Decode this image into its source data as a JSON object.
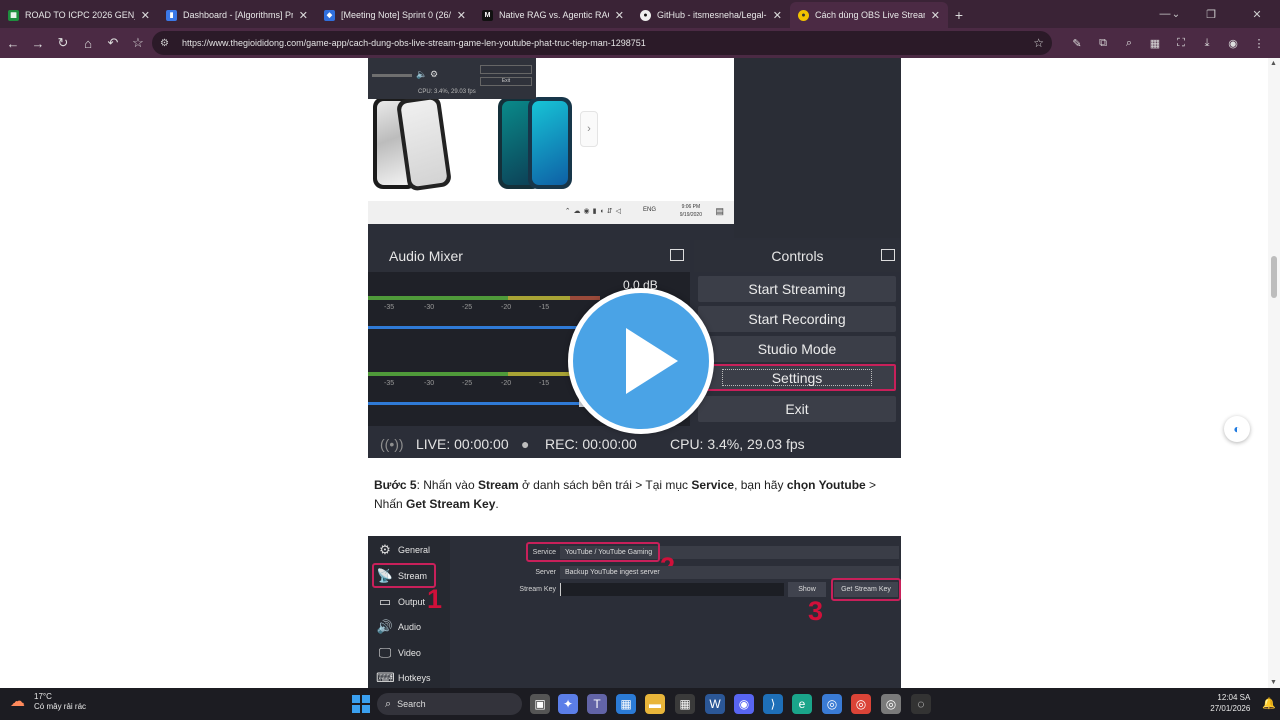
{
  "browser": {
    "tabs": [
      {
        "title": "ROAD TO ICPC 2026 GEN_TEST",
        "favicon": "sheets-icon",
        "color": "#1e8e3e",
        "active": false
      },
      {
        "title": "Dashboard - [Algorithms] Prefix",
        "favicon": "chart-icon",
        "color": "#3b78e7",
        "active": false
      },
      {
        "title": "[Meeting Note] Sprint 0 (26/01)",
        "favicon": "jira-icon",
        "color": "#2f6fde",
        "active": false
      },
      {
        "title": "Native RAG vs. Agentic RAG: W",
        "favicon": "medium-icon",
        "color": "#111111",
        "active": false
      },
      {
        "title": "GitHub - itsmesneha/Legal-Ch",
        "favicon": "github-icon",
        "color": "#eeeeee",
        "active": false
      },
      {
        "title": "Cách dùng OBS Live Stream ga",
        "favicon": "tgdd-icon",
        "color": "#f2c200",
        "active": true
      }
    ],
    "url": "https://www.thegioididong.com/game-app/cach-dung-obs-live-stream-game-len-youtube-phat-truc-tiep-man-1298751"
  },
  "screenshot1": {
    "mini_obs_stat": "CPU: 3.4%, 29.03 fps",
    "mini_obs_button": "Exit",
    "tray_time": "9:06 PM",
    "tray_date": "9/19/2020",
    "tray_lang": "ENG",
    "audio_mixer_title": "Audio Mixer",
    "controls_title": "Controls",
    "db_value": "0.0 dB",
    "scale_ticks": [
      "-35",
      "-30",
      "-25",
      "-20",
      "-15",
      "-10"
    ],
    "buttons": [
      "Start Streaming",
      "Start Recording",
      "Studio Mode",
      "Settings",
      "Exit"
    ],
    "highlighted_button": "Settings",
    "live": "LIVE: 00:00:00",
    "rec": "REC: 00:00:00",
    "cpu": "CPU: 3.4%, 29.03 fps"
  },
  "article": {
    "step_label": "Bước 5",
    "p1": ": Nhấn vào ",
    "b1": "Stream",
    "p2": " ở danh sách bên trái > Tại mục ",
    "b2": "Service",
    "p3": ", bạn hãy ",
    "b3": "chọn Youtube",
    "p4": " > Nhấn ",
    "b4": "Get Stream Key",
    "p5": "."
  },
  "screenshot2": {
    "sidebar": [
      {
        "label": "General",
        "icon": "gear-icon"
      },
      {
        "label": "Stream",
        "icon": "antenna-icon"
      },
      {
        "label": "Output",
        "icon": "output-icon"
      },
      {
        "label": "Audio",
        "icon": "speaker-icon"
      },
      {
        "label": "Video",
        "icon": "monitor-icon"
      },
      {
        "label": "Hotkeys",
        "icon": "keyboard-icon"
      }
    ],
    "service_label": "Service",
    "service_value": "YouTube / YouTube Gaming",
    "server_label": "Server",
    "server_value": "Backup YouTube ingest server",
    "stream_key_label": "Stream Key",
    "show_button": "Show",
    "get_key_button": "Get Stream Key",
    "step_numbers": [
      "1",
      "2",
      "3"
    ],
    "highlight_color": "#c8205a"
  },
  "play_button": {
    "color": "#4aa3e6"
  },
  "taskbar": {
    "temperature": "17°C",
    "weather_text": "Có mây rải rác",
    "search": "Search",
    "time": "12:04 SA",
    "date": "27/01/2026"
  }
}
